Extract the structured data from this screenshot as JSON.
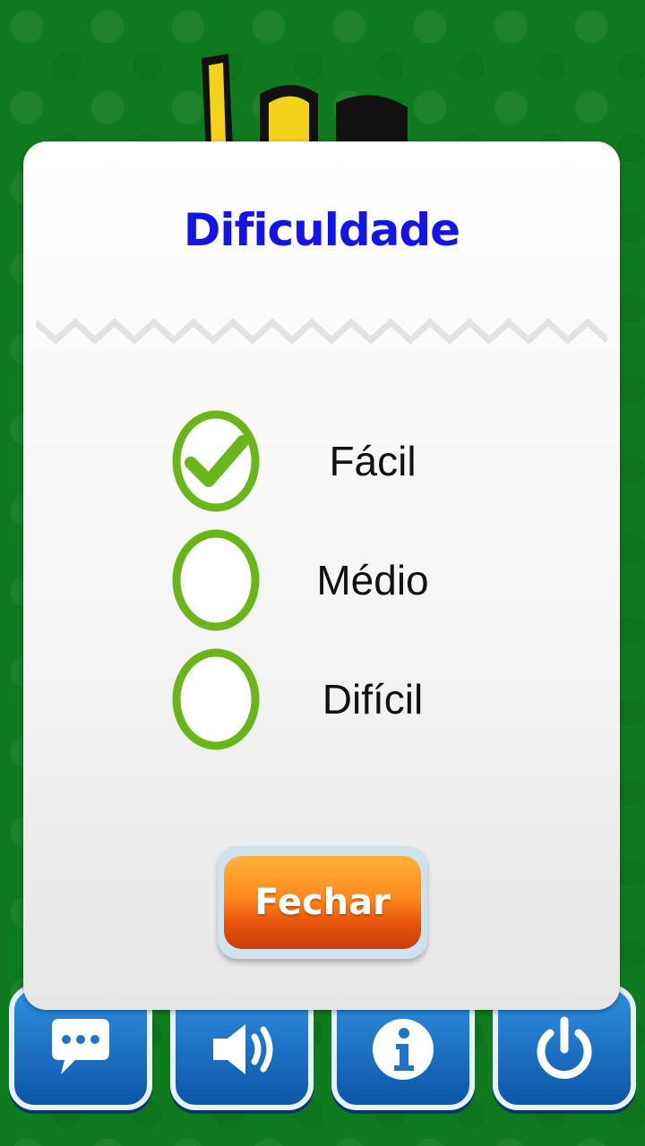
{
  "dialog": {
    "title": "Dificuldade",
    "options": [
      {
        "label": "Fácil",
        "selected": true
      },
      {
        "label": "Médio",
        "selected": false
      },
      {
        "label": "Difícil",
        "selected": false
      }
    ],
    "close_label": "Fechar"
  },
  "bottom_bar": {
    "icons": [
      "chat-icon",
      "speaker-icon",
      "info-icon",
      "power-icon"
    ]
  },
  "colors": {
    "background": "#0f7a1e",
    "title": "#1414e6",
    "radio": "#6ab51a",
    "close_button": "#ff8a1c",
    "bottom_buttons": "#1f74c8"
  }
}
